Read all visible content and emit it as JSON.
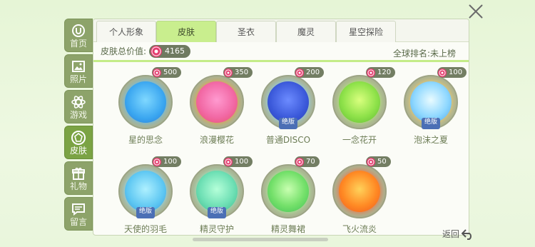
{
  "sidebar": {
    "items": [
      {
        "label": "首页",
        "icon": "home-icon"
      },
      {
        "label": "照片",
        "icon": "photo-icon"
      },
      {
        "label": "游戏",
        "icon": "game-icon"
      },
      {
        "label": "皮肤",
        "icon": "skin-icon"
      },
      {
        "label": "礼物",
        "icon": "gift-icon"
      },
      {
        "label": "留言",
        "icon": "message-icon"
      }
    ]
  },
  "tabs": [
    {
      "label": "个人形象"
    },
    {
      "label": "皮肤"
    },
    {
      "label": "圣衣"
    },
    {
      "label": "魔灵"
    },
    {
      "label": "星空探险"
    }
  ],
  "info": {
    "total_label": "皮肤总价值:",
    "total_value": "4165",
    "rank_label": "全球排名:未上榜"
  },
  "skins": [
    {
      "name": "星的思念",
      "price": "500"
    },
    {
      "name": "浪漫樱花",
      "price": "350"
    },
    {
      "name": "普通DISCO",
      "price": "200",
      "badge": "绝版"
    },
    {
      "name": "一念花开",
      "price": "120"
    },
    {
      "name": "泡沫之夏",
      "price": "100",
      "badge": "绝版"
    },
    {
      "name": "天使的羽毛",
      "price": "100",
      "badge": "绝版"
    },
    {
      "name": "精灵守护",
      "price": "100",
      "badge": "绝版"
    },
    {
      "name": "精灵舞裙",
      "price": "70"
    },
    {
      "name": "飞火流炎",
      "price": "50"
    }
  ],
  "back_label": "返回",
  "colors": {
    "active_tab": "#c9ee8e",
    "sidebar": "#8da36a",
    "sidebar_active": "#7ba344"
  }
}
